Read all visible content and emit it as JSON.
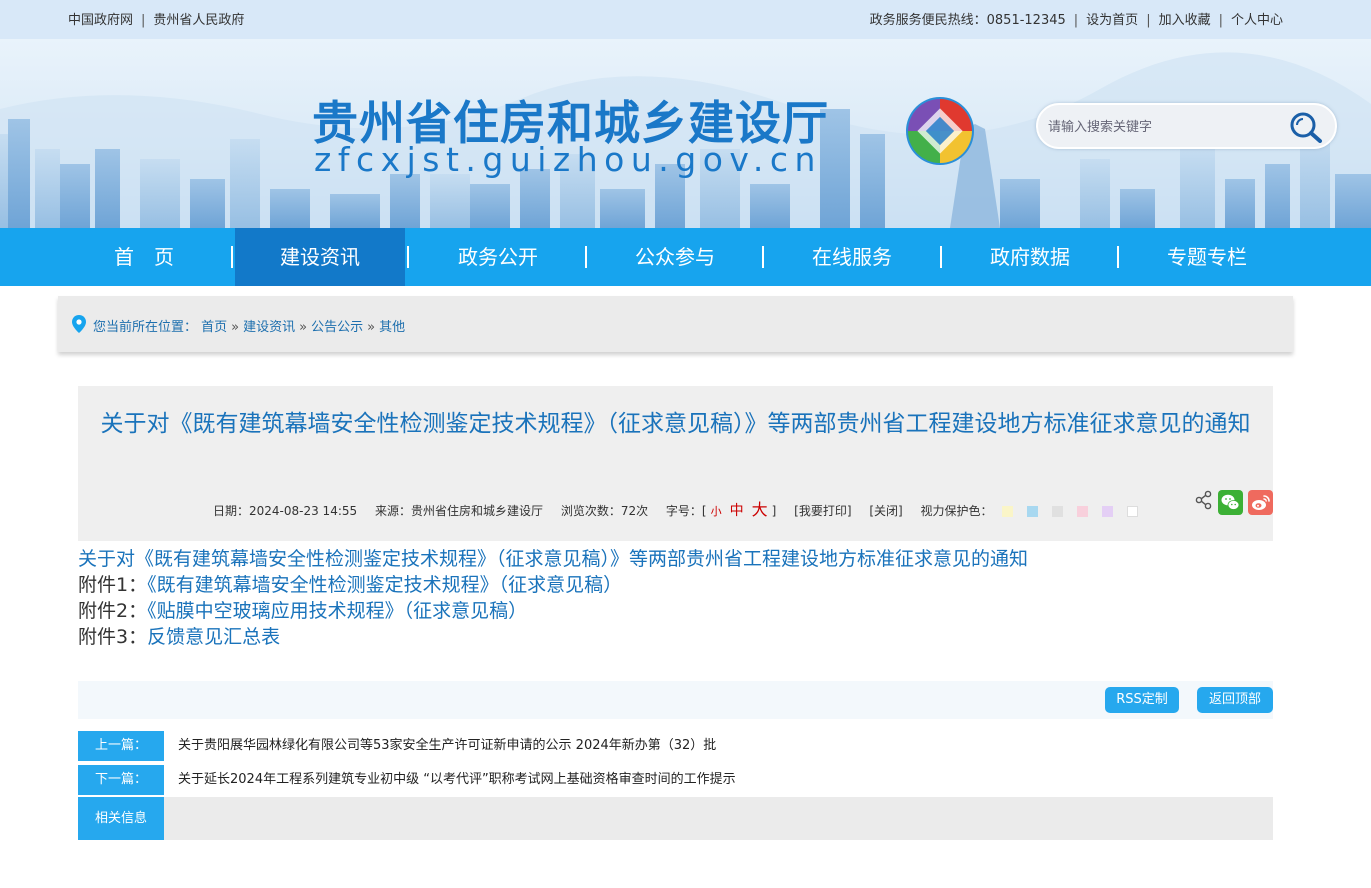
{
  "topbar": {
    "links_left": [
      "中国政府网",
      "贵州省人民政府"
    ],
    "hotline": "政务服务便民热线：0851-12345",
    "links_right": [
      "设为首页",
      "加入收藏",
      "个人中心"
    ]
  },
  "header": {
    "title": "贵州省住房和城乡建设厅",
    "domain": "zfcxjst.guizhou.gov.cn",
    "search_placeholder": "请输入搜索关键字"
  },
  "nav": {
    "items": [
      "首　页",
      "建设资讯",
      "政务公开",
      "公众参与",
      "在线服务",
      "政府数据",
      "专题专栏"
    ],
    "active_index": 1
  },
  "breadcrumb": {
    "label": "您当前所在位置：",
    "items": [
      "首页",
      "建设资讯",
      "公告公示",
      "其他"
    ],
    "separator": "»"
  },
  "article": {
    "title": "关于对《既有建筑幕墙安全性检测鉴定技术规程》（征求意见稿）》等两部贵州省工程建设地方标准征求意见的通知",
    "date": "日期：2024-08-23 14:55",
    "source": "来源：贵州省住房和城乡建设厅",
    "views": "浏览次数：72次",
    "fontsize_label": "字号：[",
    "fontsize_options": [
      "小",
      "中",
      "大"
    ],
    "fontsize_close": "]",
    "print": "[我要打印]",
    "close": "[关闭]",
    "eyecare_label": "视力保护色：",
    "eyecare_colors": [
      "#faf5c8",
      "#a8d8f0",
      "#e0e0e0",
      "#f8d0dc",
      "#e4cff5",
      "#ffffff"
    ]
  },
  "body": {
    "line1": "关于对《既有建筑幕墙安全性检测鉴定技术规程》（征求意见稿）》等两部贵州省工程建设地方标准征求意见的通知",
    "attachments": [
      {
        "prefix": "附件1：",
        "text": "《既有建筑幕墙安全性检测鉴定技术规程》（征求意见稿）"
      },
      {
        "prefix": "附件2：",
        "text": "《贴膜中空玻璃应用技术规程》（征求意见稿）"
      },
      {
        "prefix": "附件3：",
        "text": "反馈意见汇总表"
      }
    ]
  },
  "actions": {
    "rss": "RSS定制",
    "top": "返回顶部"
  },
  "prevnext": {
    "prev_label": "上一篇：",
    "prev_text": "关于贵阳展华园林绿化有限公司等53家安全生产许可证新申请的公示 2024年新办第（32）批",
    "next_label": "下一篇：",
    "next_text": "关于延长2024年工程系列建筑专业初中级 “以考代评”职称考试网上基础资格审查时间的工作提示",
    "related_label": "相关信息"
  },
  "colors": {
    "nav": "#17a4ee",
    "nav_active": "#1279c9",
    "link": "#1a73bb",
    "button": "#26a8ee"
  }
}
